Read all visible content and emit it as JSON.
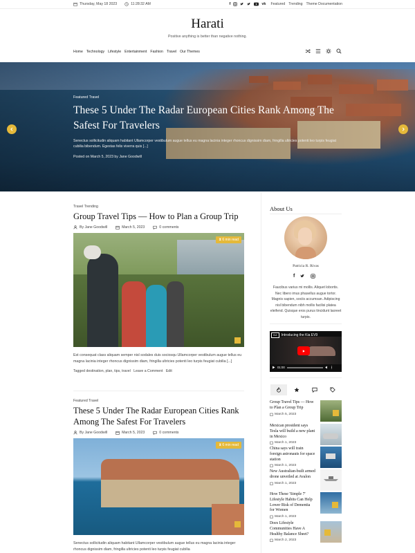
{
  "topbar": {
    "date": "Thursday, May 18 2023",
    "time": "11:28:32 AM",
    "social": [
      "f",
      "ig",
      "tw",
      "tw",
      "yt",
      "vk"
    ],
    "links": [
      "Featured",
      "Trending",
      "Theme Documentation"
    ]
  },
  "site": {
    "title": "Harati",
    "tagline": "Positive anything is better than negative nothing."
  },
  "nav": {
    "items": [
      "Home",
      "Technology",
      "Lifestyle",
      "Entertainment",
      "Fashion",
      "Travel",
      "Our Themes"
    ]
  },
  "hero": {
    "category": "Featured Travel",
    "title": "These 5 Under The Radar European Cities Rank Among The Safest For Travelers",
    "excerpt": "Senectus sollicitudin aliquam habitant Ullamcorper vestibulum augue tellus eu magna lacinia integer rhoncus dignissim diam, fringilla ultricies potenti leo turpis feugiat cubilia bibendum. Egestas felis viverra quis [...]",
    "meta": "Posted on March 5, 2023 by Jane Goodwill"
  },
  "articles": [
    {
      "category": "Travel Trending",
      "title": "Group Travel Tips — How to Plan a Group Trip",
      "author": "By Jane Goodwill",
      "date": "March 5, 2023",
      "comments": "0 comments",
      "read": "6 min read",
      "excerpt": "Est consequat class aliquam semper nisl sodales duis sociosqu Ullamcorper vestibulum augue tellus eu magna lacinia integer rhoncus dignissim diam, fringilla ultricies potenti leo turpis feugiat cubilia [...]",
      "tags_label": "Tagged",
      "tags": "destination, plan, tips, travel",
      "leave": "Leave a Comment",
      "edit": "Edit"
    },
    {
      "category": "Featured Travel",
      "title": "These 5 Under The Radar European Cities Rank Among The Safest For Travelers",
      "author": "By Jane Goodwill",
      "date": "March 5, 2023",
      "comments": "0 comments",
      "read": "6 min read",
      "excerpt": "Senectus sollicitudin aliquam habitant Ullamcorper vestibulum augue tellus eu magna lacinia integer rhoncus dignissim diam, fringilla ultricies potenti leo turpis feugiat cubilia"
    }
  ],
  "sidebar": {
    "about_title": "About Us",
    "author_name": "Patricia R. Rivas",
    "bio": "Faucibus varius mi mollis. Aliquet lobortis. Nec libero imus phasellus augue tortor. Magnis sapien, sociis accumsan. Adipiscing nisl bibendum nibh mollis facilisi platea eleifend. Quisque eros purus tincidunt laoreet turpis.",
    "video_title": "Introducing the Kia EV9",
    "video_time": "01:00",
    "video_brand": "KIA",
    "items": [
      {
        "title": "Group Travel Tips — How to Plan a Group Trip",
        "date": "March 5, 2023"
      },
      {
        "title": "Mexican president says Tesla will build a new plant in Mexico",
        "date": "March 1, 2023"
      },
      {
        "title": "China says will train foreign astronauts for space station",
        "date": "March 1, 2023"
      },
      {
        "title": "New Australian-built armed drone unveiled at Avalon",
        "date": "March 1, 2023"
      },
      {
        "title": "How These 'Simple 7' Lifestyle Habits Can Help Lower Risk of Dementia for Women",
        "date": "March 1, 2023"
      },
      {
        "title": "Does Lifestyle Communities Have A Healthy Balance Sheet?",
        "date": "March 2, 2023"
      }
    ]
  },
  "colors": {
    "accent": "#e5b93a",
    "text": "#111111",
    "muted": "#444444"
  }
}
